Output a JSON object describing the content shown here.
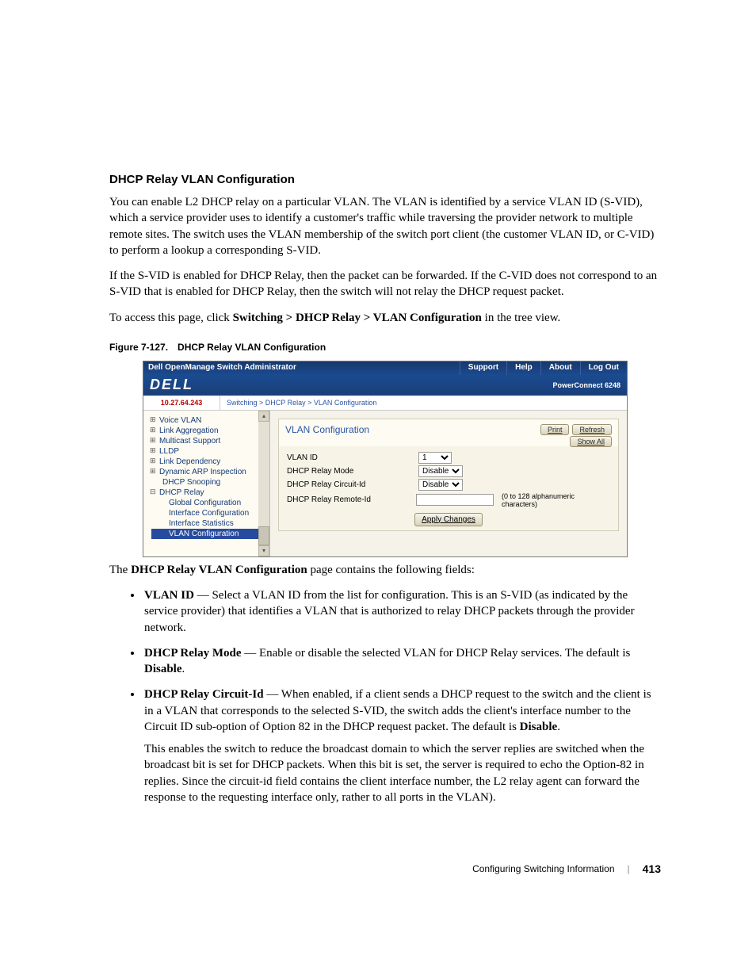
{
  "section_heading": "DHCP Relay VLAN Configuration",
  "para1": "You can enable L2 DHCP relay on a particular VLAN. The VLAN is identified by a service VLAN ID (S-VID), which a service provider uses to identify a customer's traffic while traversing the provider network to multiple remote sites. The switch uses the VLAN membership of the switch port client (the customer VLAN ID, or C-VID) to perform a lookup a corresponding S-VID.",
  "para2": "If the S-VID is enabled for DHCP Relay, then the packet can be forwarded. If the C-VID does not correspond to an S-VID that is enabled for DHCP Relay, then the switch will not relay the DHCP request packet.",
  "nav_sentence_prefix": "To access this page, click ",
  "nav_sentence_bold": "Switching > DHCP Relay > VLAN Configuration",
  "nav_sentence_suffix": " in the tree view.",
  "figure_num": "Figure 7-127.",
  "figure_title": "DHCP Relay VLAN Configuration",
  "screenshot": {
    "topbar_title": "Dell OpenManage Switch Administrator",
    "btn_support": "Support",
    "btn_help": "Help",
    "btn_about": "About",
    "btn_logout": "Log Out",
    "logo": "DELL",
    "product": "PowerConnect 6248",
    "ip": "10.27.64.243",
    "crumb": "Switching > DHCP Relay > VLAN Configuration",
    "tree": {
      "voice_vlan": "Voice VLAN",
      "link_agg": "Link Aggregation",
      "multicast": "Multicast Support",
      "lldp": "LLDP",
      "link_dep": "Link Dependency",
      "arp": "Dynamic ARP Inspection",
      "snoop": "DHCP Snooping",
      "dhcp_relay": "DHCP Relay",
      "global": "Global Configuration",
      "iface_conf": "Interface Configuration",
      "iface_stats": "Interface Statistics",
      "vlan_conf": "VLAN Configuration"
    },
    "panel": {
      "title": "VLAN Configuration",
      "btn_print": "Print",
      "btn_refresh": "Refresh",
      "btn_showall": "Show All",
      "lbl_vlan_id": "VLAN ID",
      "lbl_mode": "DHCP Relay Mode",
      "lbl_circuit": "DHCP Relay Circuit-Id",
      "lbl_remote": "DHCP Relay Remote-Id",
      "val_vlan_id": "1",
      "val_mode": "Disable",
      "val_circuit": "Disable",
      "hint_remote": "(0 to 128 alphanumeric characters)",
      "btn_apply": "Apply Changes"
    }
  },
  "below_intro_prefix": "The ",
  "below_intro_bold": "DHCP Relay VLAN Configuration",
  "below_intro_suffix": " page contains the following fields:",
  "fields": {
    "vlan_id_label": "VLAN ID",
    "vlan_id_text": " — Select a VLAN ID from the list for configuration. This is an S-VID (as indicated by the service provider) that identifies a VLAN that is authorized to relay DHCP packets through the provider network.",
    "mode_label": "DHCP Relay Mode",
    "mode_text": " — Enable or disable the selected VLAN for DHCP Relay services. The default is ",
    "mode_default": "Disable",
    "circuit_label": "DHCP Relay Circuit-Id",
    "circuit_text": " — When enabled, if a client sends a DHCP request to the switch and the client is in a VLAN that corresponds to the selected S-VID, the switch adds the client's interface number to the Circuit ID sub-option of Option 82 in the DHCP request packet. The default is ",
    "circuit_default": "Disable",
    "circuit_para2": "This enables the switch to reduce the broadcast domain to which the server replies are switched when the broadcast bit is set for DHCP packets. When this bit is set, the server is required to echo the Option-82 in replies. Since the circuit-id field contains the client interface number, the L2 relay agent can forward the response to the requesting interface only, rather to all ports in the VLAN)."
  },
  "footer_text": "Configuring Switching Information",
  "footer_page": "413"
}
